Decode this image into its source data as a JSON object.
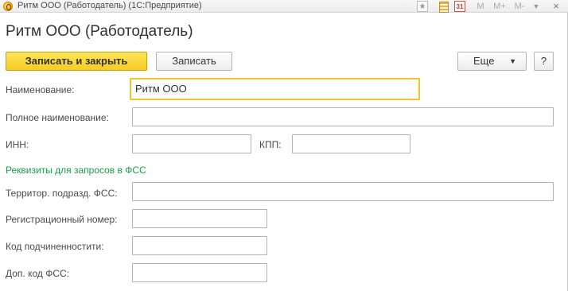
{
  "window": {
    "title": "Ритм ООО (Работодатель)  (1С:Предприятие)",
    "toolbar": {
      "favorite_icon": "star-icon",
      "calc_icon": "calculator-icon",
      "calendar_label": "31",
      "m_label": "M",
      "m_plus_label": "M+",
      "m_minus_label": "M-",
      "menu_glyph": "▼",
      "close_glyph": "×"
    }
  },
  "form": {
    "title": "Ритм ООО (Работодатель)",
    "buttons": {
      "save_close": "Записать и закрыть",
      "save": "Записать",
      "more": "Еще",
      "more_caret": "▼",
      "help": "?"
    },
    "fields": {
      "name": {
        "label": "Наименование:",
        "value": "Ритм ООО"
      },
      "full_name": {
        "label": "Полное наименование:",
        "value": ""
      },
      "inn": {
        "label": "ИНН:",
        "value": ""
      },
      "kpp": {
        "label": "КПП:",
        "value": ""
      },
      "fss_subdivision": {
        "label": "Территор. подразд. ФСС:",
        "value": ""
      },
      "reg_number": {
        "label": "Регистрационный номер:",
        "value": ""
      },
      "subordination_code": {
        "label": "Код подчиненностити:",
        "value": ""
      },
      "extra_fss_code": {
        "label": "Доп. код ФСС:",
        "value": ""
      }
    },
    "section_fss": "Реквизиты для запросов в ФСС"
  },
  "colors": {
    "primary_button": "#f6cc22",
    "focus_border": "#f2c530",
    "section_green": "#1f9b4a"
  }
}
